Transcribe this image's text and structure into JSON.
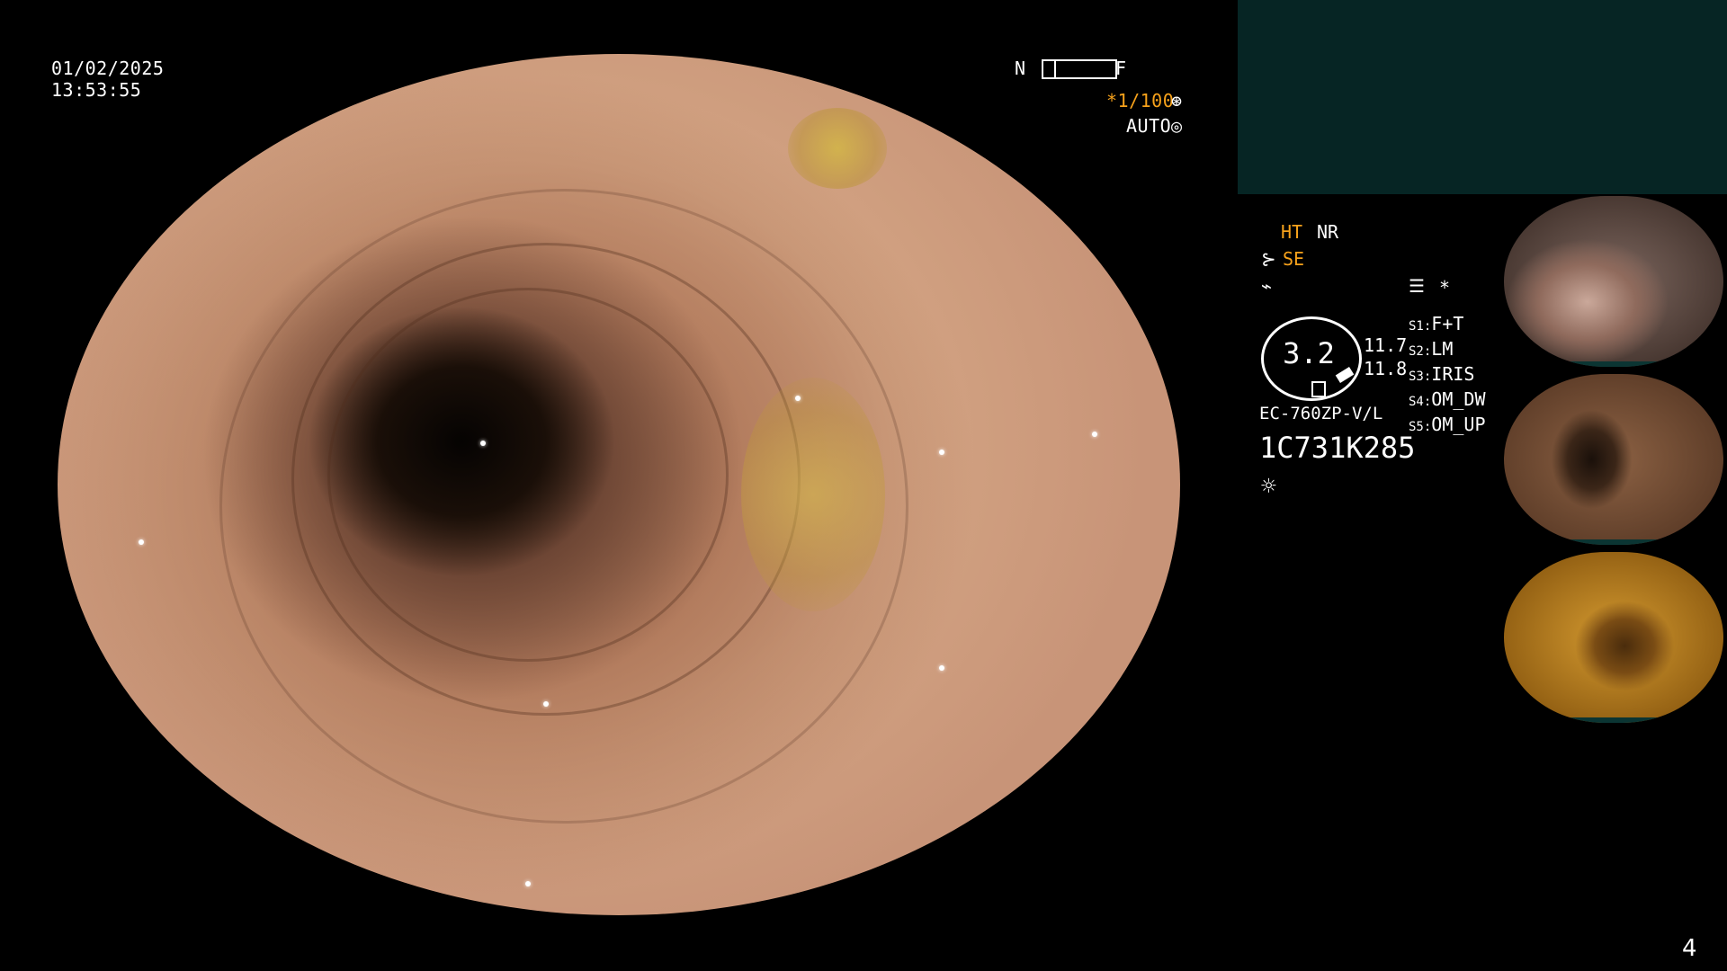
{
  "datetime": {
    "date": "01/02/2025",
    "time": "13:53:55"
  },
  "focus": {
    "near": "N",
    "far": "F"
  },
  "shutter": {
    "value": "*1/100",
    "icon": "shutter-icon"
  },
  "iris": {
    "label": "AUTO",
    "icon": "iris-icon"
  },
  "settings": {
    "ht": "HT",
    "nr": "NR",
    "se": "SE",
    "se_icon": "scope-icon",
    "flash_icon": "lightning-icon",
    "menu_icon": "list-icon",
    "star": "*"
  },
  "gauge": {
    "value": "3.2",
    "reading_1": "11.7",
    "reading_2": "11.8"
  },
  "scope": {
    "model": "EC-760ZP-V/L",
    "serial": "1C731K285",
    "light_icon": "sun-icon"
  },
  "switches": [
    {
      "key": "S1:",
      "value": "F+T"
    },
    {
      "key": "S2:",
      "value": "LM"
    },
    {
      "key": "S3:",
      "value": "IRIS"
    },
    {
      "key": "S4:",
      "value": "OM_DW"
    },
    {
      "key": "S5:",
      "value": "OM_UP"
    }
  ],
  "page_number": "4",
  "colors": {
    "accent": "#f7a21b",
    "panel": "#062524",
    "background": "#000000"
  }
}
